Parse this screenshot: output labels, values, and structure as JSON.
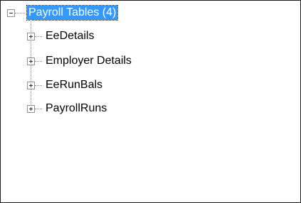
{
  "tree": {
    "root": {
      "label": "Payroll Tables (4)",
      "expanded": true,
      "selected": true
    },
    "children": [
      {
        "label": "EeDetails",
        "expanded": false
      },
      {
        "label": "Employer Details",
        "expanded": false
      },
      {
        "label": "EeRunBals",
        "expanded": false
      },
      {
        "label": "PayrollRuns",
        "expanded": false
      }
    ]
  },
  "colors": {
    "selection": "#3399ff",
    "border": "#1c1c1c",
    "connector": "#8a8a8a"
  }
}
